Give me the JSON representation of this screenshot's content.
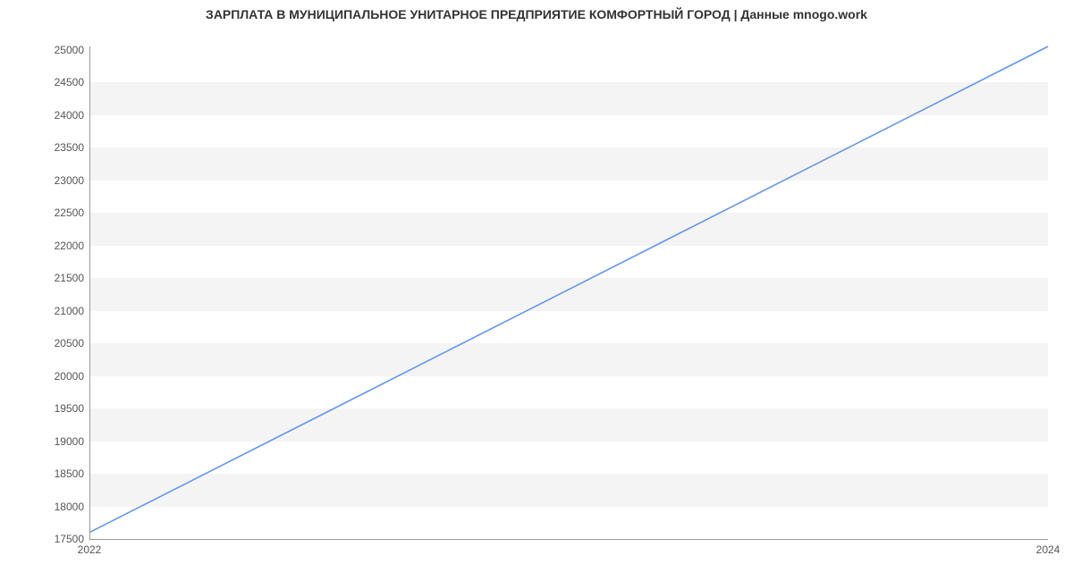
{
  "chart_data": {
    "type": "line",
    "title": "ЗАРПЛАТА В МУНИЦИПАЛЬНОЕ УНИТАРНОЕ ПРЕДПРИЯТИЕ КОМФОРТНЫЙ ГОРОД | Данные mnogo.work",
    "x": [
      2022,
      2024
    ],
    "values": [
      17600,
      25050
    ],
    "xlabel": "",
    "ylabel": "",
    "x_ticks": [
      2022,
      2024
    ],
    "y_ticks": [
      17500,
      18000,
      18500,
      19000,
      19500,
      20000,
      20500,
      21000,
      21500,
      22000,
      22500,
      23000,
      23500,
      24000,
      24500,
      25000
    ],
    "xlim": [
      2022,
      2024
    ],
    "ylim": [
      17500,
      25050
    ],
    "line_color": "#6495ed"
  }
}
